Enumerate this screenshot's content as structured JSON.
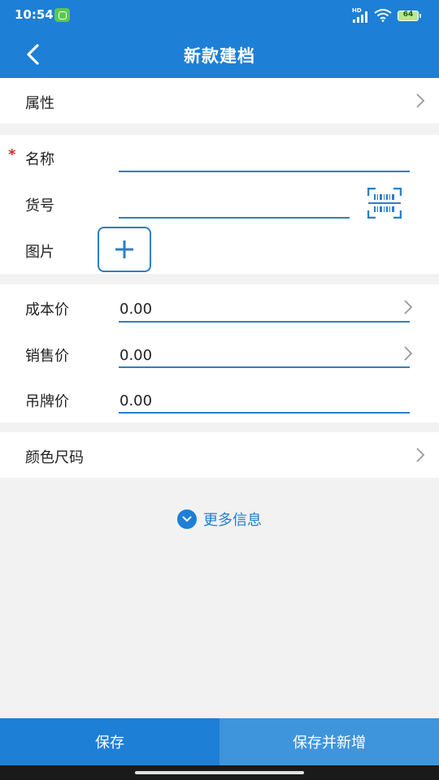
{
  "status_bar": {
    "time": "10:54",
    "network_label": "HD",
    "battery_level": "64",
    "icons": [
      "app-badge-icon",
      "signal-icon",
      "wifi-icon",
      "battery-icon"
    ]
  },
  "header": {
    "title": "新款建档",
    "back_icon": "chevron-left-icon"
  },
  "attributes": {
    "label": "属性"
  },
  "basic_info": {
    "name_label": "名称",
    "name_required_mark": "*",
    "name_value": "",
    "item_no_label": "货号",
    "item_no_value": "",
    "image_label": "图片"
  },
  "prices": {
    "cost_label": "成本价",
    "cost_value": "0.00",
    "sale_label": "销售价",
    "sale_value": "0.00",
    "tag_label": "吊牌价",
    "tag_value": "0.00"
  },
  "color_size": {
    "label": "颜色尺码"
  },
  "more_info": {
    "label": "更多信息"
  },
  "actions": {
    "save_label": "保存",
    "save_new_label": "保存并新增"
  },
  "colors": {
    "primary": "#1e7fd6",
    "secondary_button": "#3f95dc",
    "required": "#d32f2f",
    "background": "#f2f2f2"
  }
}
